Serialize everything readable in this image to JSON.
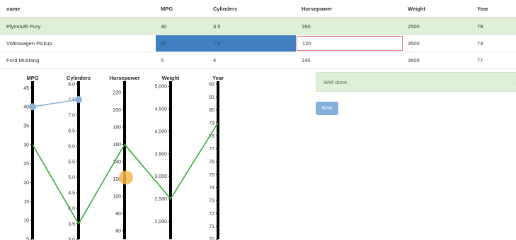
{
  "table": {
    "headers": [
      "name",
      "MPG",
      "Cylinders",
      "Horsepower",
      "Weight",
      "Year"
    ],
    "rows": [
      [
        "Plymouth Fury",
        "30",
        "3.5",
        "160",
        "2500",
        "79"
      ],
      [
        "Volkswagen Pickup",
        "40",
        "7.5",
        "120",
        "3500",
        "73"
      ],
      [
        "Ford Mustang",
        "5",
        "4",
        "140",
        "3500",
        "77"
      ]
    ]
  },
  "colors": {
    "highlight_row": "#dff0d8",
    "selected_cell": "#4080c0",
    "editing_border": "#e07a7a",
    "green_line": "#3aa83a",
    "blue_line": "#8ab0dc",
    "orange_handle": "#f7b84b",
    "button": "#85aedb"
  },
  "axes": [
    {
      "title": "MPG",
      "ticks": [
        "45",
        "40",
        "35",
        "30",
        "25",
        "20",
        "15",
        "10",
        "5"
      ],
      "min": 5,
      "max": 46
    },
    {
      "title": "Cylinders",
      "ticks": [
        "8.0",
        "7.5",
        "7.0",
        "6.5",
        "6.0",
        "5.5",
        "5.0",
        "4.5",
        "4.0",
        "3.5",
        "3.0"
      ],
      "min": 3,
      "max": 8
    },
    {
      "title": "Horsepower",
      "ticks": [
        "220",
        "200",
        "180",
        "160",
        "140",
        "120",
        "100",
        "80",
        "60"
      ],
      "min": 50,
      "max": 230
    },
    {
      "title": "Weight",
      "ticks": [
        "5,000",
        "4,500",
        "4,000",
        "3,500",
        "3,000",
        "2,500",
        "2,000"
      ],
      "min": 1600,
      "max": 5050
    },
    {
      "title": "Year",
      "ticks": [
        "82",
        "81",
        "80",
        "79",
        "78",
        "77",
        "76",
        "75",
        "74",
        "73",
        "72",
        "71",
        "70"
      ],
      "min": 70,
      "max": 82
    }
  ],
  "lines": {
    "green": {
      "mpg": 30,
      "cylinders": 3.5,
      "horsepower": 160,
      "weight": 2500,
      "year": 79
    },
    "blue_partial": {
      "mpg": 40,
      "cylinders": 7.5
    },
    "orange_handle_value": {
      "axis": "Horsepower",
      "value": 120
    }
  },
  "alert": {
    "message": "Well done.",
    "close": "›"
  },
  "next_button": {
    "label": "Next"
  }
}
